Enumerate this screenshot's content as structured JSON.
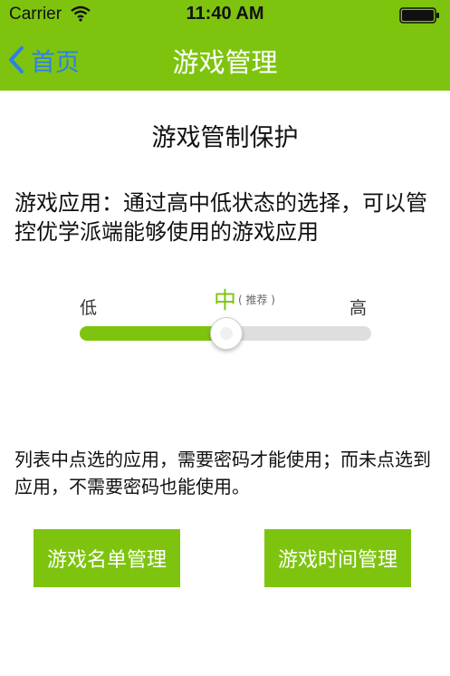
{
  "status_bar": {
    "carrier": "Carrier",
    "time": "11:40 AM"
  },
  "nav": {
    "back_label": "首页",
    "title": "游戏管理"
  },
  "section_title": "游戏管制保护",
  "description": "游戏应用：通过高中低状态的选择，可以管控优学派端能够使用的游戏应用",
  "levels": {
    "low": "低",
    "mid": "中",
    "mid_note": "( 推荐 )",
    "high": "高",
    "selected": "中",
    "position_fraction": 0.5
  },
  "note": "列表中点选的应用，需要密码才能使用；而未点选到应用，不需要密码也能使用。",
  "buttons": {
    "game_list": "游戏名单管理",
    "game_time": "游戏时间管理"
  },
  "colors": {
    "accent": "#7ec40f",
    "back_link": "#2e80e8",
    "track": "#dedede"
  },
  "icons": {
    "wifi": "wifi-icon",
    "battery": "battery-icon",
    "back": "chevron-left-icon"
  }
}
